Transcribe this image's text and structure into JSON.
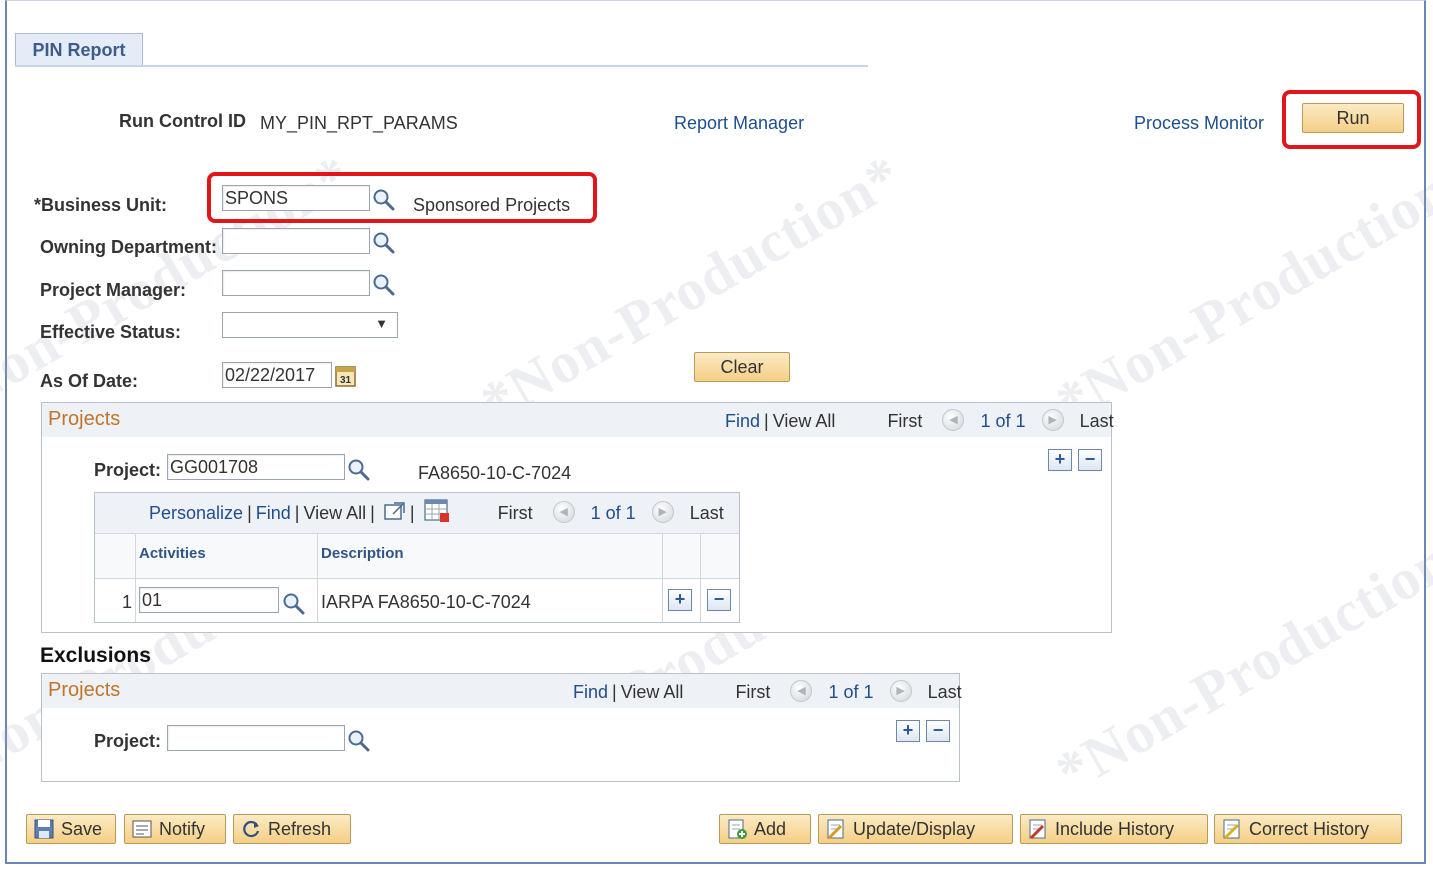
{
  "tab": {
    "label": "PIN Report"
  },
  "header": {
    "run_control_label": "Run Control ID",
    "run_control_value": "MY_PIN_RPT_PARAMS",
    "report_manager": "Report Manager",
    "process_monitor": "Process Monitor",
    "run_label": "Run"
  },
  "form": {
    "business_unit_label": "*Business Unit:",
    "business_unit_value": "SPONS",
    "business_unit_desc": "Sponsored Projects",
    "owning_dept_label": "Owning Department:",
    "owning_dept_value": "",
    "project_manager_label": "Project Manager:",
    "project_manager_value": "",
    "effective_status_label": "Effective Status:",
    "effective_status_value": "",
    "as_of_date_label": "As Of Date:",
    "as_of_date_value": "02/22/2017",
    "clear_label": "Clear"
  },
  "projects": {
    "title": "Projects",
    "find": "Find",
    "view_all": "View All",
    "first": "First",
    "counter": "1 of 1",
    "last": "Last",
    "project_label": "Project:",
    "project_value": "GG001708",
    "project_desc": "FA8650-10-C-7024",
    "activities_grid": {
      "personalize": "Personalize",
      "find": "Find",
      "view_all": "View All",
      "first": "First",
      "counter": "1 of 1",
      "last": "Last",
      "col_activities": "Activities",
      "col_description": "Description",
      "row_num": "1",
      "row_activity": "01",
      "row_description": "IARPA FA8650-10-C-7024"
    }
  },
  "exclusions": {
    "heading": "Exclusions",
    "title": "Projects",
    "find": "Find",
    "view_all": "View All",
    "first": "First",
    "counter": "1 of 1",
    "last": "Last",
    "project_label": "Project:",
    "project_value": ""
  },
  "toolbar": {
    "save": "Save",
    "notify": "Notify",
    "refresh": "Refresh",
    "add": "Add",
    "update_display": "Update/Display",
    "include_history": "Include History",
    "correct_history": "Correct History"
  },
  "watermark": "*Non-Production*",
  "colors": {
    "link": "#1f4e8c",
    "group_title": "#c0752b",
    "highlight": "#e2161a",
    "button_top": "#fcebc4",
    "button_bottom": "#f4cf85"
  }
}
